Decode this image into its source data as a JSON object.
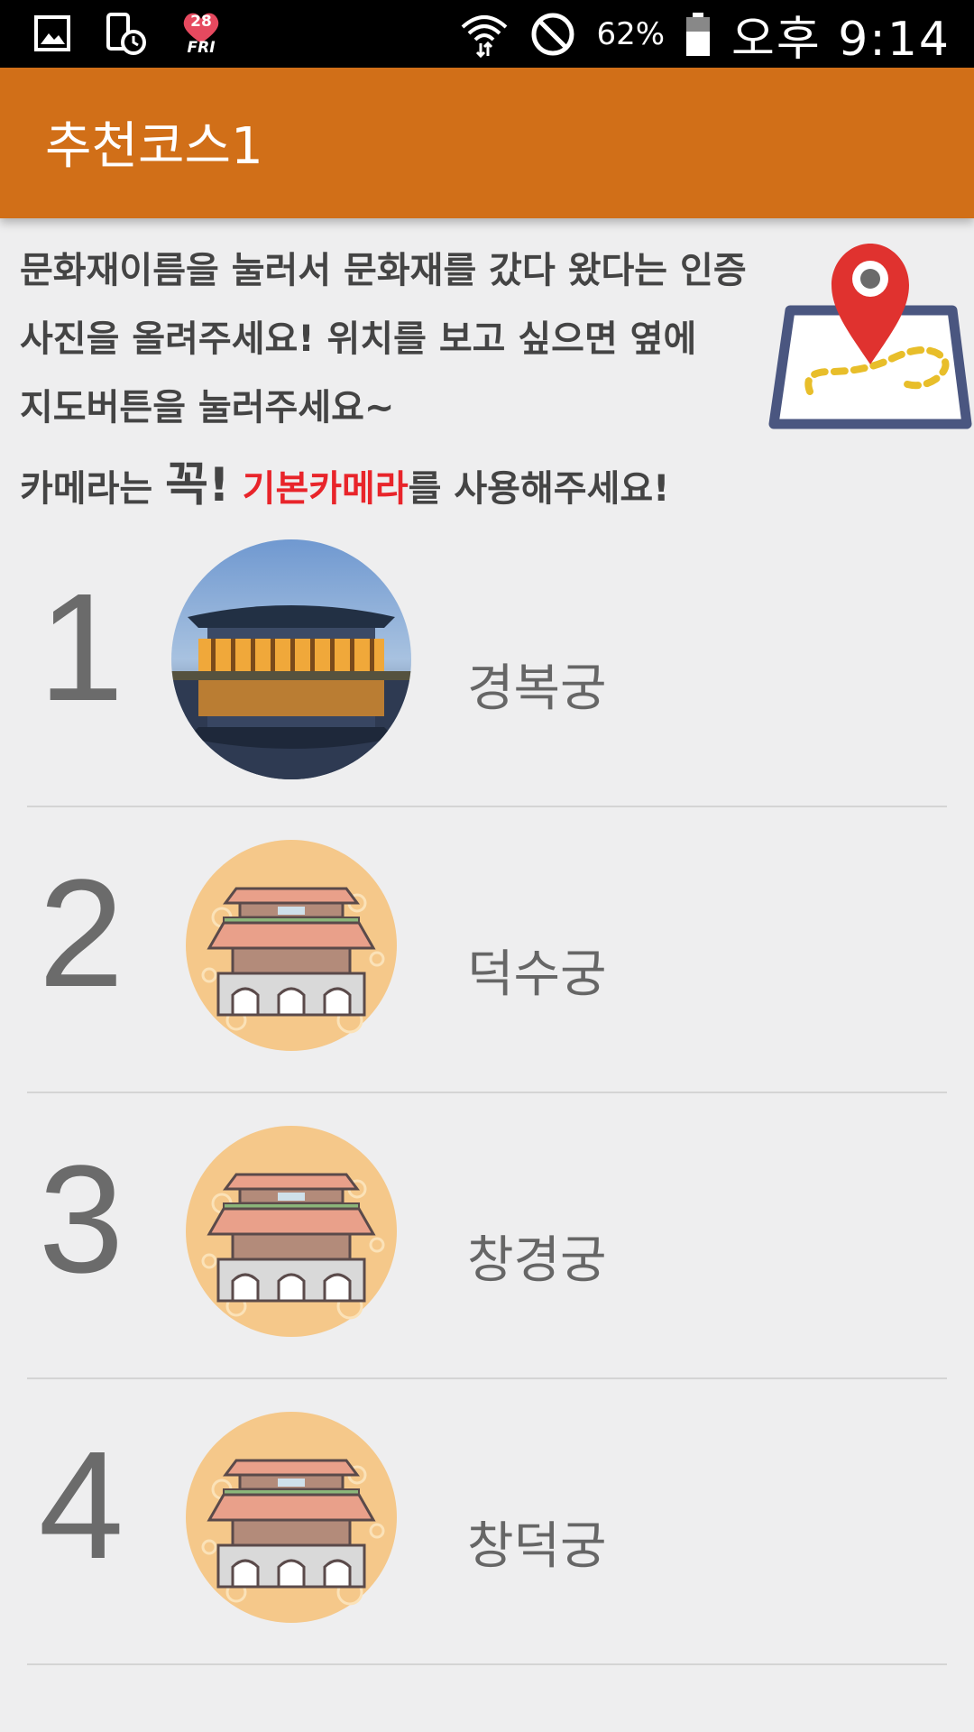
{
  "status_bar": {
    "notification_icons": [
      "image-icon",
      "device-schedule-icon",
      "calendar-heart-icon"
    ],
    "calendar_day": "28",
    "calendar_weekday": "FRI",
    "battery_percent": "62%",
    "time": "오후 9:14"
  },
  "app_bar": {
    "title": "추천코스1",
    "color": "#d16f18"
  },
  "instructions": {
    "line1": "문화재이름을 눌러서 문화재를 갔다 왔다는 인증",
    "line2": "사진을 올려주세요! 위치를 보고 싶으면 옆에",
    "line3": "지도버튼을 눌러주세요~",
    "line4_part1": "카메라는 ",
    "line4_emphasis": "꼭!",
    "line4_space": " ",
    "line4_highlight": "기본카메라",
    "line4_part2": "를 사용해주세요!",
    "highlight_color": "#e8242a",
    "map_button_icon": "map-pin-icon"
  },
  "course": [
    {
      "number": "1",
      "name": "경복궁",
      "image": "gyeongbokgung-photo"
    },
    {
      "number": "2",
      "name": "덕수궁",
      "image": "palace-icon"
    },
    {
      "number": "3",
      "name": "창경궁",
      "image": "palace-icon"
    },
    {
      "number": "4",
      "name": "창덕궁",
      "image": "palace-icon"
    }
  ]
}
